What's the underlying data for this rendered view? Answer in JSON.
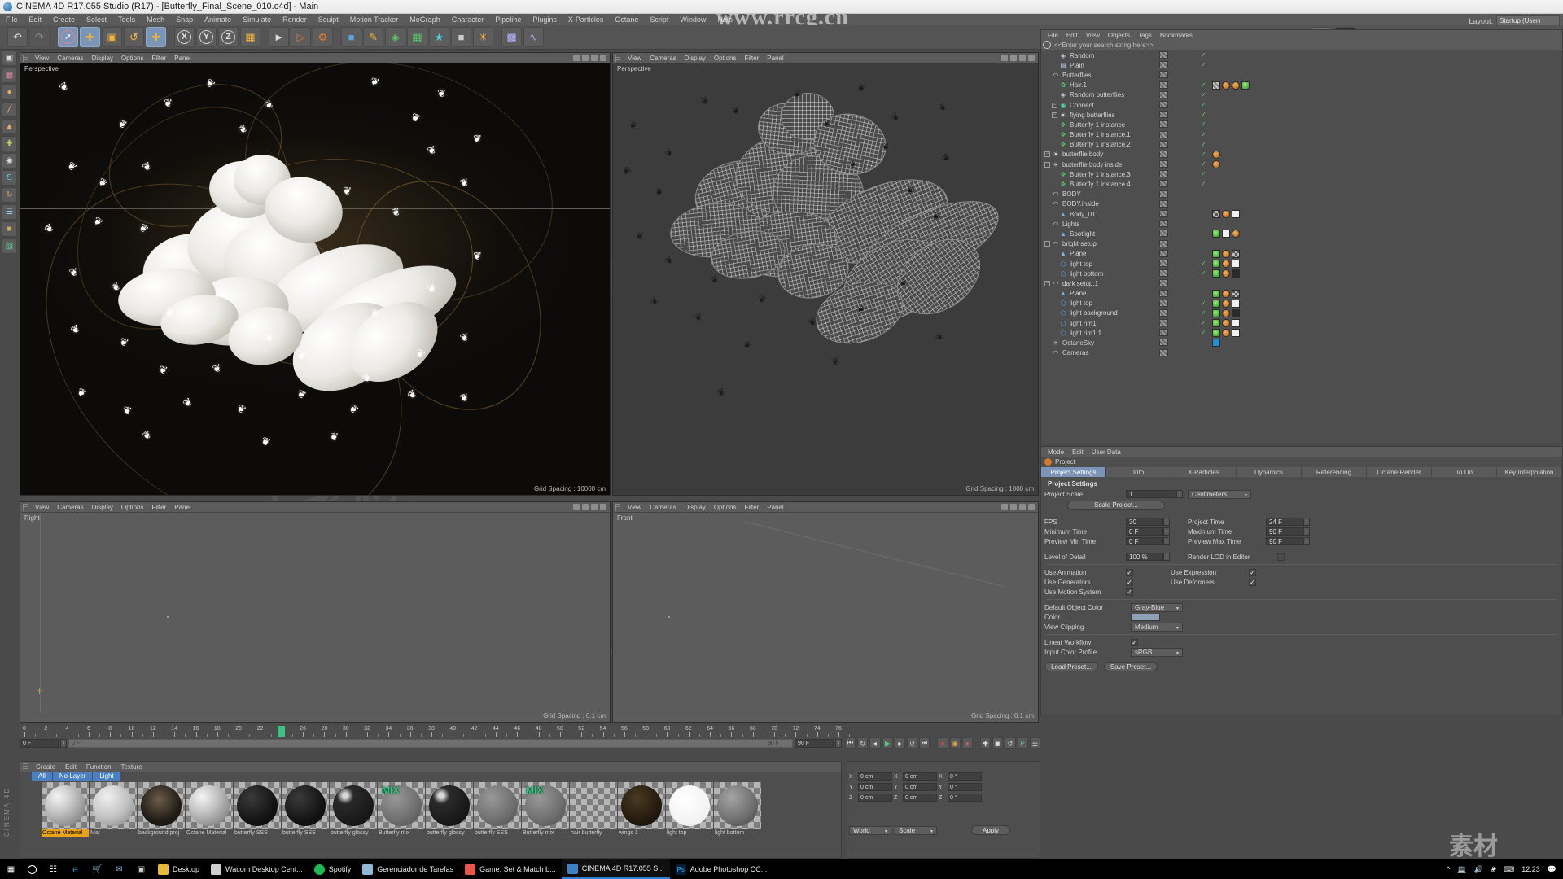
{
  "titlebar": {
    "text": "CINEMA 4D R17.055 Studio (R17) - [Butterfly_Final_Scene_010.c4d] - Main"
  },
  "watermark": {
    "top": "www.rrcg.cn",
    "cn": "人人素材社区"
  },
  "menubar": {
    "items": [
      "File",
      "Edit",
      "Create",
      "Select",
      "Tools",
      "Mesh",
      "Snap",
      "Animate",
      "Simulate",
      "Render",
      "Sculpt",
      "Motion Tracker",
      "MoGraph",
      "Character",
      "Pipeline",
      "Plugins",
      "X-Particles",
      "Octane",
      "Script",
      "Window",
      "Help"
    ]
  },
  "layout": {
    "label": "Layout:",
    "value": "Startup (User)"
  },
  "viewport_menu": [
    "View",
    "Cameras",
    "Display",
    "Options",
    "Filter",
    "Panel"
  ],
  "viewports": [
    {
      "name": "Perspective",
      "grid": "Grid Spacing : 10000 cm"
    },
    {
      "name": "Perspective",
      "grid": "Grid Spacing : 1000 cm"
    },
    {
      "name": "Right",
      "grid": "Grid Spacing : 0.1 cm"
    },
    {
      "name": "Front",
      "grid": "Grid Spacing : 0.1 cm"
    }
  ],
  "object_manager": {
    "menu": [
      "File",
      "Edit",
      "View",
      "Objects",
      "Tags",
      "Bookmarks"
    ],
    "search_placeholder": "<<Enter your search string here>>",
    "nodes": [
      {
        "label": "Random",
        "depth": 1,
        "toggle": "",
        "icon": "mograph-random-icon",
        "color": "#b8c6e0",
        "check": true,
        "dot": "#8a8a8a",
        "tags": []
      },
      {
        "label": "Plain",
        "depth": 1,
        "toggle": "",
        "icon": "mograph-plain-icon",
        "color": "#b8c6e0",
        "check": true,
        "dot": "#8a8a8a",
        "tags": []
      },
      {
        "label": "Butterflies",
        "depth": 0,
        "toggle": "",
        "icon": "null-object-icon",
        "color": "#d6d6d6",
        "check": false,
        "dot": "#8a8a8a",
        "tags": []
      },
      {
        "label": "Hair.1",
        "depth": 1,
        "toggle": "",
        "icon": "hair-icon",
        "color": "#4fc46a",
        "check": true,
        "dot": "#8a8a8a",
        "tags": [
          "stripe",
          "orange",
          "orange",
          "green"
        ]
      },
      {
        "label": "Random butterflies",
        "depth": 1,
        "toggle": "",
        "icon": "mograph-random-icon",
        "color": "#b8c6e0",
        "check": true,
        "dot": "#8a8a8a",
        "tags": []
      },
      {
        "label": "Connect",
        "depth": 1,
        "toggle": "+",
        "icon": "connect-icon",
        "color": "#4fd0a0",
        "check": true,
        "dot": "#d06a2a",
        "tags": []
      },
      {
        "label": "flying butterflies",
        "depth": 1,
        "toggle": "+",
        "icon": "cloner-icon",
        "color": "#d8d8d8",
        "check": true,
        "dot": "#8a8a8a",
        "tags": []
      },
      {
        "label": "Butterfly 1 instance",
        "depth": 1,
        "toggle": "",
        "icon": "instance-icon",
        "color": "#4fc46a",
        "check": true,
        "dot": "#8a8a8a",
        "tags": []
      },
      {
        "label": "Butterfly 1 instance.1",
        "depth": 1,
        "toggle": "",
        "icon": "instance-icon",
        "color": "#4fc46a",
        "check": true,
        "dot": "#8a8a8a",
        "tags": []
      },
      {
        "label": "Butterfly 1 instance.2",
        "depth": 1,
        "toggle": "",
        "icon": "instance-icon",
        "color": "#4fc46a",
        "check": true,
        "dot": "#8a8a8a",
        "tags": []
      },
      {
        "label": "butterflie body",
        "depth": 0,
        "toggle": "+",
        "icon": "cloner-icon",
        "color": "#d8d8d8",
        "check": true,
        "dot": "#8a8a8a",
        "tags": [
          "orange"
        ]
      },
      {
        "label": "butterflie body inside",
        "depth": 0,
        "toggle": "+",
        "icon": "cloner-icon",
        "color": "#d8d8d8",
        "check": true,
        "dot": "#8a8a8a",
        "tags": [
          "orange"
        ]
      },
      {
        "label": "Butterfly 1 instance.3",
        "depth": 1,
        "toggle": "",
        "icon": "instance-icon",
        "color": "#4fc46a",
        "check": true,
        "dot": "#8a8a8a",
        "tags": []
      },
      {
        "label": "Butterfly 1 instance.4",
        "depth": 1,
        "toggle": "",
        "icon": "instance-icon",
        "color": "#4fc46a",
        "check": true,
        "dot": "#8a8a8a",
        "tags": []
      },
      {
        "label": "BODY",
        "depth": 0,
        "toggle": "",
        "icon": "null-object-icon",
        "color": "#d6d6d6",
        "check": false,
        "dot": "#8a8a8a",
        "tags": []
      },
      {
        "label": "BODY.inside",
        "depth": 0,
        "toggle": "",
        "icon": "null-object-icon",
        "color": "#d6d6d6",
        "check": false,
        "dot": "#d06a2a",
        "tags": []
      },
      {
        "label": "Body_011",
        "depth": 1,
        "toggle": "",
        "icon": "polygon-object-icon",
        "color": "#7ab7e8",
        "check": false,
        "dot": "#d06a2a",
        "tags": [
          "checker",
          "orange",
          "white"
        ]
      },
      {
        "label": "Lights",
        "depth": 0,
        "toggle": "",
        "icon": "null-object-icon",
        "color": "#d6d6d6",
        "check": false,
        "dot": "#d06a2a",
        "tags": []
      },
      {
        "label": "Spotlight",
        "depth": 1,
        "toggle": "",
        "icon": "polygon-object-icon",
        "color": "#7ab7e8",
        "check": false,
        "dot": "#d06a2a",
        "tags": [
          "green",
          "white",
          "orange"
        ]
      },
      {
        "label": "bright setup",
        "depth": 0,
        "toggle": "+",
        "icon": "null-object-icon",
        "color": "#d6d6d6",
        "check": false,
        "dot": "#8a8a8a",
        "tags": []
      },
      {
        "label": "Plane",
        "depth": 1,
        "toggle": "",
        "icon": "polygon-object-icon",
        "color": "#7ab7e8",
        "check": false,
        "dot": "#8a8a8a",
        "tags": [
          "green",
          "orange",
          "checker"
        ]
      },
      {
        "label": "light top",
        "depth": 1,
        "toggle": "",
        "icon": "light-icon",
        "color": "#5ba3e0",
        "check": true,
        "dot": "#8a8a8a",
        "tags": [
          "green",
          "orange",
          "white"
        ]
      },
      {
        "label": "light bottom",
        "depth": 1,
        "toggle": "",
        "icon": "light-icon",
        "color": "#5ba3e0",
        "check": true,
        "dot": "#8a8a8a",
        "tags": [
          "green",
          "orange",
          "dark"
        ]
      },
      {
        "label": "dark setup.1",
        "depth": 0,
        "toggle": "+",
        "icon": "null-object-icon",
        "color": "#d6d6d6",
        "check": false,
        "dot": "#d06a2a",
        "tags": []
      },
      {
        "label": "Plane",
        "depth": 1,
        "toggle": "",
        "icon": "polygon-object-icon",
        "color": "#7ab7e8",
        "check": false,
        "dot": "#8a8a8a",
        "tags": [
          "green",
          "orange",
          "checker"
        ]
      },
      {
        "label": "light top",
        "depth": 1,
        "toggle": "",
        "icon": "light-icon",
        "color": "#5ba3e0",
        "check": true,
        "dot": "#8a8a8a",
        "tags": [
          "green",
          "orange",
          "white"
        ]
      },
      {
        "label": "light background",
        "depth": 1,
        "toggle": "",
        "icon": "light-icon",
        "color": "#5ba3e0",
        "check": true,
        "dot": "#8a8a8a",
        "tags": [
          "green",
          "orange",
          "dark"
        ]
      },
      {
        "label": "light rim1",
        "depth": 1,
        "toggle": "",
        "icon": "light-icon",
        "color": "#5ba3e0",
        "check": true,
        "dot": "#8a8a8a",
        "tags": [
          "green",
          "orange",
          "white"
        ]
      },
      {
        "label": "light rim1.1",
        "depth": 1,
        "toggle": "",
        "icon": "light-icon",
        "color": "#5ba3e0",
        "check": true,
        "dot": "#8a8a8a",
        "tags": [
          "green",
          "orange",
          "white"
        ]
      },
      {
        "label": "OctaneSky",
        "depth": 0,
        "toggle": "",
        "icon": "octane-sky-icon",
        "color": "#c8c8c8",
        "check": false,
        "dot": "#d06a2a",
        "tags": [
          "blue"
        ]
      },
      {
        "label": "Cameras",
        "depth": 0,
        "toggle": "",
        "icon": "null-object-icon",
        "color": "#d6d6d6",
        "check": false,
        "dot": "#d06a2a",
        "tags": []
      }
    ]
  },
  "attribute_manager": {
    "menu": [
      "Mode",
      "Edit",
      "User Data"
    ],
    "object": "Project",
    "tabs": [
      "Project Settings",
      "Info",
      "X-Particles",
      "Dynamics",
      "Referencing",
      "Octane Render",
      "To Do",
      "Key Interpolation"
    ],
    "active_tab": "Project Settings",
    "section": "Project Settings",
    "fields": {
      "project_scale_label": "Project Scale",
      "project_scale_value": "1",
      "project_scale_unit": "Centimeters",
      "scale_project_button": "Scale Project...",
      "fps_label": "FPS",
      "fps_value": "30",
      "project_time_label": "Project Time",
      "project_time_value": "24 F",
      "min_time_label": "Minimum Time",
      "min_time_value": "0 F",
      "max_time_label": "Maximum Time",
      "max_time_value": "90 F",
      "preview_min_label": "Preview Min Time",
      "preview_min_value": "0 F",
      "preview_max_label": "Preview Max Time",
      "preview_max_value": "90 F",
      "lod_label": "Level of Detail",
      "lod_value": "100 %",
      "render_lod_label": "Render LOD in Editor",
      "use_animation_label": "Use Animation",
      "use_expression_label": "Use Expression",
      "use_generators_label": "Use Generators",
      "use_deformers_label": "Use Deformers",
      "use_motion_label": "Use Motion System",
      "default_color_label": "Default Object Color",
      "default_color_value": "Gray-Blue",
      "color_label": "Color",
      "view_clipping_label": "View Clipping",
      "view_clipping_value": "Medium",
      "linear_workflow_label": "Linear Workflow",
      "input_profile_label": "Input Color Profile",
      "input_profile_value": "sRGB",
      "load_preset_button": "Load Preset...",
      "save_preset_button": "Save Preset..."
    }
  },
  "timeline": {
    "ticks": [
      0,
      2,
      4,
      6,
      8,
      10,
      12,
      14,
      16,
      18,
      20,
      22,
      24,
      26,
      28,
      30,
      32,
      34,
      36,
      38,
      40,
      42,
      44,
      46,
      48,
      50,
      52,
      54,
      56,
      58,
      60,
      62,
      64,
      66,
      68,
      70,
      72,
      74,
      76
    ],
    "current_frame": "24",
    "start_field": "0 F",
    "track_start": "0 F",
    "track_end": "90 F",
    "end_field": "90 F"
  },
  "material_manager": {
    "menu": [
      "Create",
      "Edit",
      "Function",
      "Texture"
    ],
    "layers": [
      "All",
      "No Layer",
      "Light"
    ],
    "materials": [
      {
        "name": "Octane Material",
        "preview": "moon",
        "selected": true,
        "mix": false
      },
      {
        "name": "Mat",
        "preview": "plain",
        "selected": false,
        "mix": false
      },
      {
        "name": "background proj",
        "preview": "dark-spec",
        "selected": false,
        "mix": false
      },
      {
        "name": "Octane Material",
        "preview": "moon",
        "selected": false,
        "mix": false
      },
      {
        "name": "butterfly SSS",
        "preview": "black",
        "selected": false,
        "mix": false
      },
      {
        "name": "butterfly SSS",
        "preview": "black",
        "selected": false,
        "mix": false
      },
      {
        "name": "butterfly glossy",
        "preview": "glossy",
        "selected": false,
        "mix": false
      },
      {
        "name": "Butterfly mix",
        "preview": "gray",
        "selected": false,
        "mix": true
      },
      {
        "name": "butterfly glossy",
        "preview": "glossy",
        "selected": false,
        "mix": false
      },
      {
        "name": "butterfly SSS",
        "preview": "gray",
        "selected": false,
        "mix": false
      },
      {
        "name": "Butterfly mix",
        "preview": "gray",
        "selected": false,
        "mix": true
      },
      {
        "name": "hair butterfly",
        "preview": "empty",
        "selected": false,
        "mix": false
      },
      {
        "name": "wings 1",
        "preview": "brown",
        "selected": false,
        "mix": false
      },
      {
        "name": "light top",
        "preview": "white",
        "selected": false,
        "mix": false
      },
      {
        "name": "light bottom",
        "preview": "midgray",
        "selected": false,
        "mix": false
      }
    ]
  },
  "coordinates": {
    "rows": [
      {
        "axis": "X",
        "pos": "0 cm",
        "size": "0 cm",
        "rot": "0 °"
      },
      {
        "axis": "Y",
        "pos": "0 cm",
        "size": "0 cm",
        "rot": "0 °"
      },
      {
        "axis": "Z",
        "pos": "0 cm",
        "size": "0 cm",
        "rot": "0 °"
      }
    ],
    "world_label": "World",
    "scale_label": "Scale",
    "apply_button": "Apply"
  },
  "taskbar": {
    "items": [
      {
        "label": "Desktop",
        "icon": "folder-icon",
        "color": "#e8b93c",
        "active": false
      },
      {
        "label": "Wacom Desktop Cent...",
        "icon": "wacom-icon",
        "color": "#cfcfcf",
        "active": false
      },
      {
        "label": "Spotify",
        "icon": "spotify-icon",
        "color": "#1db954",
        "active": false
      },
      {
        "label": "Gerenciador de Tarefas",
        "icon": "taskmgr-icon",
        "color": "#8fb8d8",
        "active": false
      },
      {
        "label": "Game, Set & Match b...",
        "icon": "chrome-icon",
        "color": "#e8584a",
        "active": false
      },
      {
        "label": "CINEMA 4D R17.055 S...",
        "icon": "c4d-icon",
        "color": "#3f7fc6",
        "active": true
      },
      {
        "label": "Adobe Photoshop CC...",
        "icon": "photoshop-icon",
        "color": "#31a8ff",
        "active": false
      }
    ],
    "clock": "12:23"
  }
}
